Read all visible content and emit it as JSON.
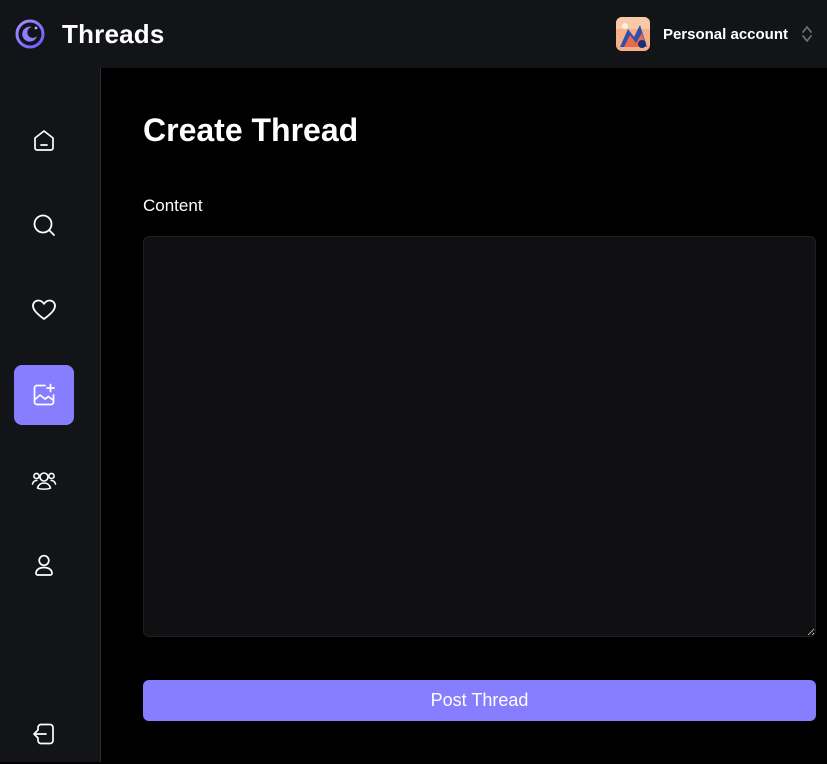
{
  "app": {
    "title": "Threads",
    "logo_icon": "threads-moon-logo-icon",
    "accent_color": "#877eff"
  },
  "account_switcher": {
    "label": "Personal account",
    "avatar_icon": "account-avatar",
    "chevron_icon": "chevron-up-down-icon"
  },
  "sidebar": {
    "items": [
      {
        "id": "home",
        "icon": "home-icon",
        "active": false
      },
      {
        "id": "search",
        "icon": "search-icon",
        "active": false
      },
      {
        "id": "activity",
        "icon": "heart-icon",
        "active": false
      },
      {
        "id": "create-thread",
        "icon": "image-plus-icon",
        "active": true
      },
      {
        "id": "communities",
        "icon": "users-icon",
        "active": false
      },
      {
        "id": "profile",
        "icon": "user-icon",
        "active": false
      }
    ],
    "logout_icon": "logout-icon"
  },
  "main": {
    "page_title": "Create Thread",
    "content_label": "Content",
    "content_value": "",
    "submit_label": "Post Thread"
  }
}
